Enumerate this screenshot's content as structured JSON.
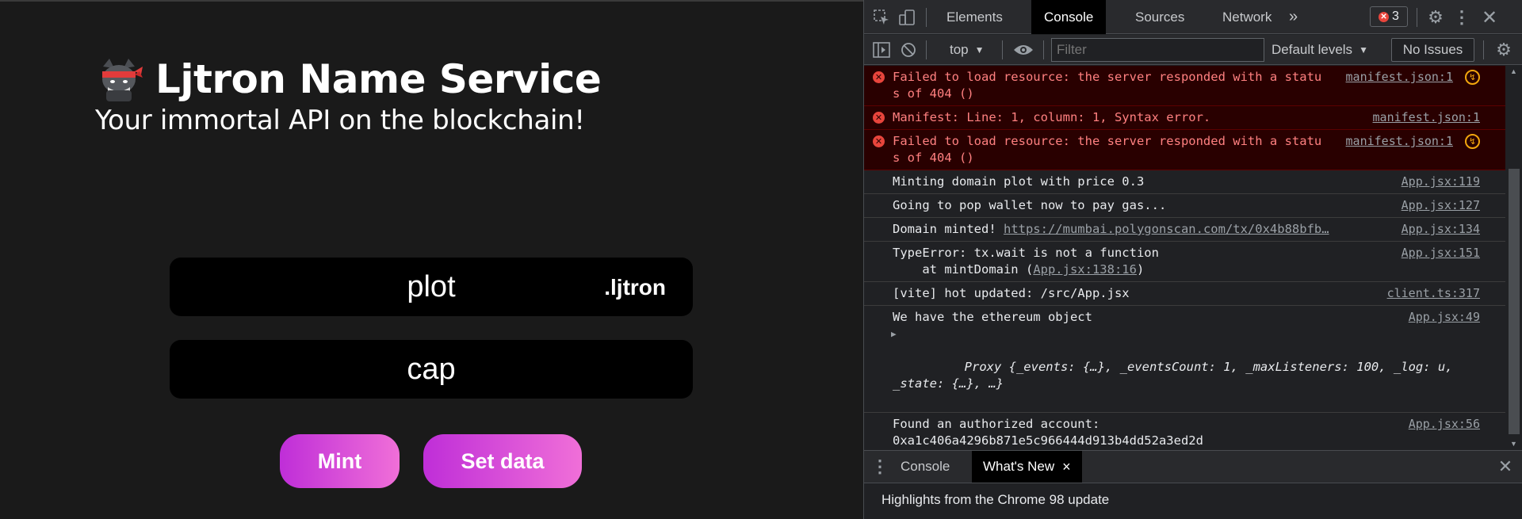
{
  "app": {
    "title": "Ljtron Name Service",
    "subtitle": "Your immortal API on the blockchain!",
    "domain_value": "plot",
    "tld": ".ljtron",
    "record_value": "cap",
    "mint_label": "Mint",
    "set_data_label": "Set data",
    "button_gradient": [
      "#bf2ed8",
      "#f06fd8"
    ]
  },
  "devtools": {
    "tabs": [
      "Elements",
      "Console",
      "Sources",
      "Network"
    ],
    "active_tab": "Console",
    "more_tabs": "»",
    "error_count": "3",
    "context": "top",
    "filter_placeholder": "Filter",
    "levels": "Default levels",
    "issues": "No Issues",
    "messages": [
      {
        "level": "error",
        "text": "Failed to load resource: the server responded with a status of 404 ()",
        "source": "manifest.json:1",
        "warn": true
      },
      {
        "level": "error",
        "text": "Manifest: Line: 1, column: 1, Syntax error.",
        "source": "manifest.json:1",
        "warn": false
      },
      {
        "level": "error",
        "text": "Failed to load resource: the server responded with a status of 404 ()",
        "source": "manifest.json:1",
        "warn": true
      },
      {
        "level": "log",
        "text": "Minting domain plot with price 0.3",
        "source": "App.jsx:119"
      },
      {
        "level": "log",
        "text": "Going to pop wallet now to pay gas...",
        "source": "App.jsx:127"
      },
      {
        "level": "log",
        "text": "Domain minted! ",
        "link": "https://mumbai.polygonscan.com/tx/0x4b88bfb…",
        "source": "App.jsx:134"
      },
      {
        "level": "log",
        "text": "TypeError: tx.wait is not a function",
        "text2_prefix": "    at mintDomain (",
        "text2_link": "App.jsx:138:16",
        "text2_suffix": ")",
        "source": "App.jsx:151"
      },
      {
        "level": "log",
        "text": "[vite] hot updated: /src/App.jsx",
        "source": "client.ts:317"
      },
      {
        "level": "log",
        "text": "We have the ethereum object",
        "source": "App.jsx:49",
        "object": "Proxy {_events: {…}, _eventsCount: 1, _maxListeners: 100, _log: u, _state: {…}, …}"
      },
      {
        "level": "log",
        "text": "Found an authorized account:",
        "text2": "0xa1c406a4296b871e5c966444d913b4dd52a3ed2d",
        "source": "App.jsx:56"
      }
    ],
    "prompt": "›",
    "drawer_tabs": [
      "Console",
      "What's New"
    ],
    "drawer_active": "What's New",
    "drawer_close": "×",
    "drawer_text": "Highlights from the Chrome 98 update",
    "colors": {
      "error_bg": "#290000",
      "error_text": "#ff8080",
      "prompt": "#5a9cf8"
    }
  }
}
